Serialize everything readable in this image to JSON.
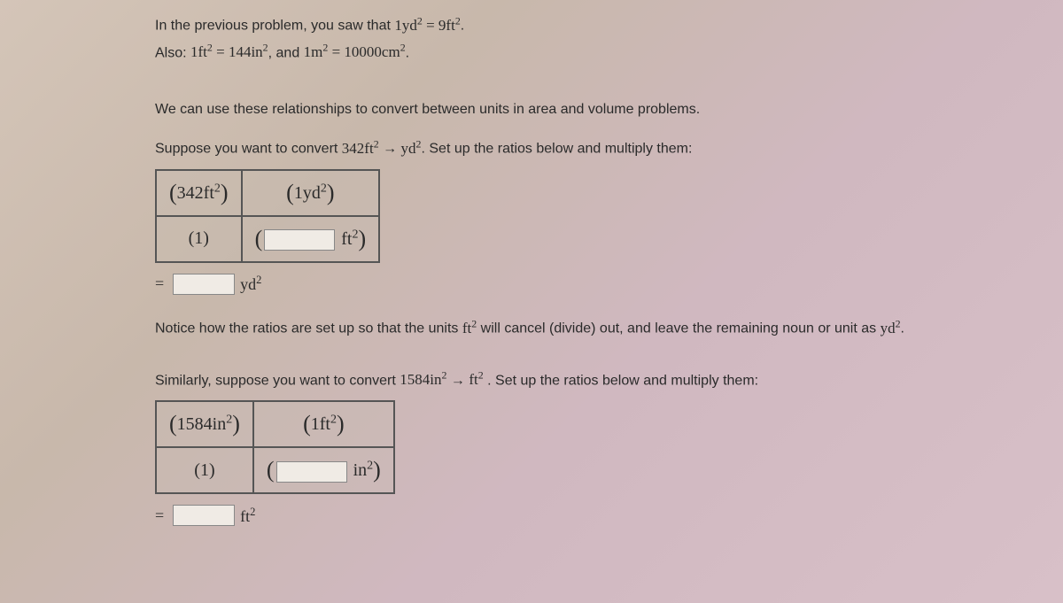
{
  "intro": {
    "line1_prefix": "In the previous problem, you saw that ",
    "line1_math": "1yd² = 9ft²",
    "line1_suffix": ".",
    "line2_prefix": "Also: ",
    "line2_math1": "1ft² = 144in²",
    "line2_mid": ", and ",
    "line2_math2": "1m² = 10000cm²",
    "line2_suffix": "."
  },
  "bridge": "We can use these relationships to convert between units in area and volume problems.",
  "problem1": {
    "prompt_prefix": "Suppose you want to convert ",
    "prompt_from": "342ft²",
    "prompt_arrow": " → ",
    "prompt_to": "yd²",
    "prompt_suffix": ". Set up the ratios below and multiply them:",
    "cell_topleft": "342ft²",
    "cell_topright_num": "1yd²",
    "cell_botleft": "(1)",
    "cell_botright_unit": "ft²",
    "result_unit": "yd²"
  },
  "notice": {
    "prefix": "Notice how the ratios are set up so that the units ",
    "math1": "ft²",
    "mid": " will cancel (divide) out, and leave the remaining noun or unit as ",
    "math2": "yd²",
    "suffix": "."
  },
  "problem2": {
    "prompt_prefix": "Similarly, suppose you want to convert ",
    "prompt_from": "1584in²",
    "prompt_arrow": " → ",
    "prompt_to": "ft²",
    "prompt_suffix": " . Set up the ratios below and multiply them:",
    "cell_topleft": "1584in²",
    "cell_topright_num": "1ft²",
    "cell_botleft": "(1)",
    "cell_botright_unit": "in²",
    "result_unit": "ft²"
  }
}
